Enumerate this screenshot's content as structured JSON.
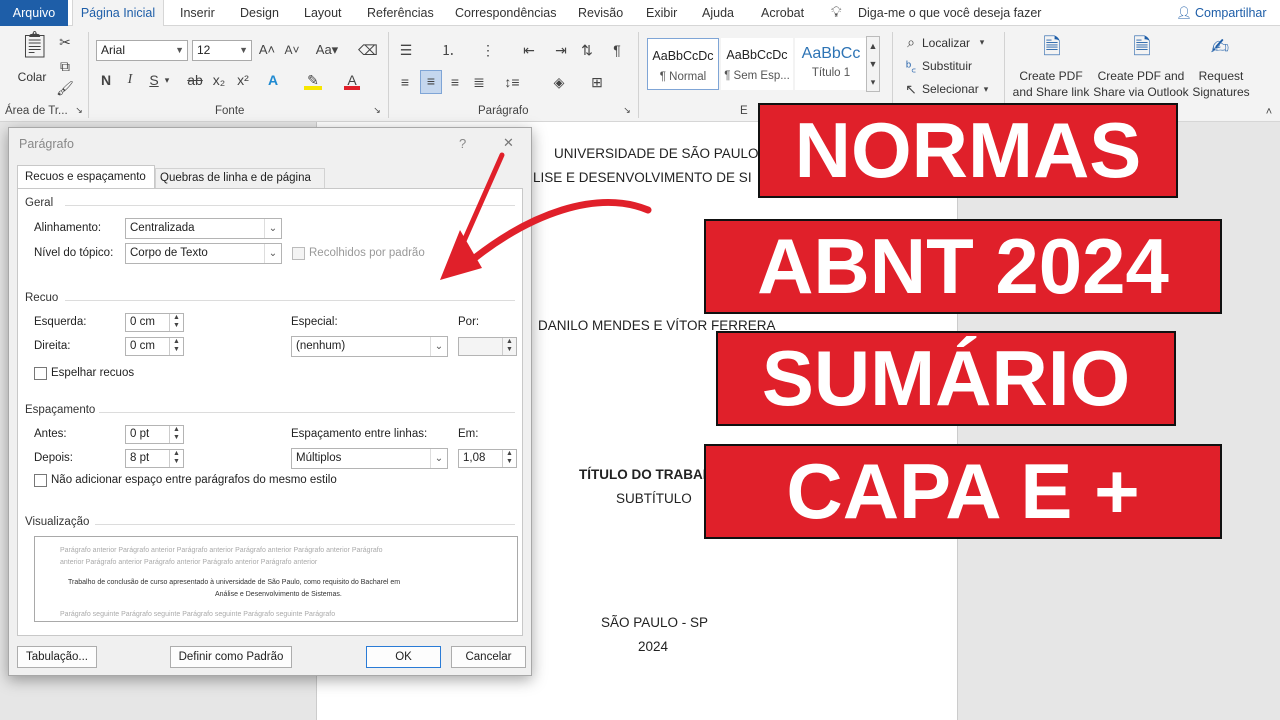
{
  "menu": {
    "file": "Arquivo",
    "tabs": [
      "Página Inicial",
      "Inserir",
      "Design",
      "Layout",
      "Referências",
      "Correspondências",
      "Revisão",
      "Exibir",
      "Ajuda",
      "Acrobat"
    ],
    "tell_me": "Diga-me o que você deseja fazer",
    "share": "Compartilhar"
  },
  "ribbon": {
    "paste": "Colar",
    "clipboard": "Área de Tr...",
    "font_name": "Arial",
    "font_size": "12",
    "font_group": "Fonte",
    "paragraph_group": "Parágrafo",
    "styles": [
      {
        "preview": "AaBbCcDc",
        "name": "¶ Normal"
      },
      {
        "preview": "AaBbCcDc",
        "name": "¶ Sem Esp..."
      },
      {
        "preview": "AaBbCc",
        "name": "Título 1"
      }
    ],
    "styles_group": "E",
    "find": "Localizar",
    "replace": "Substituir",
    "select": "Selecionar",
    "pdf1_l1": "Create PDF",
    "pdf1_l2": "and Share link",
    "pdf2_l1": "Create PDF and",
    "pdf2_l2": "Share via Outlook",
    "sig_l1": "Request",
    "sig_l2": "Signatures"
  },
  "document": {
    "university": "UNIVERSIDADE DE SÃO PAULO",
    "course": "LISE E DESENVOLVIMENTO DE SI",
    "authors": "DANILO MENDES E VÍTOR FERRERA",
    "title": "TÍTULO DO TRABAL",
    "subtitle": "SUBTÍTULO",
    "city": "SÃO PAULO - SP",
    "year": "2024"
  },
  "dialog": {
    "title": "Parágrafo",
    "help": "?",
    "close": "✕",
    "tab1": "Recuos e espaçamento",
    "tab2": "Quebras de linha e de página",
    "general": "Geral",
    "alignment_label": "Alinhamento:",
    "alignment_value": "Centralizada",
    "outline_label": "Nível do tópico:",
    "outline_value": "Corpo de Texto",
    "collapsed": "Recolhidos por padrão",
    "indent": "Recuo",
    "left_label": "Esquerda:",
    "left_value": "0 cm",
    "right_label": "Direita:",
    "right_value": "0 cm",
    "special_label": "Especial:",
    "special_value": "(nenhum)",
    "by_label": "Por:",
    "mirror": "Espelhar recuos",
    "spacing": "Espaçamento",
    "before_label": "Antes:",
    "before_value": "0 pt",
    "after_label": "Depois:",
    "after_value": "8 pt",
    "line_spacing_label": "Espaçamento entre linhas:",
    "line_spacing_value": "Múltiplos",
    "at_label": "Em:",
    "at_value": "1,08",
    "no_space": "Não adicionar espaço entre parágrafos do mesmo estilo",
    "preview": "Visualização",
    "preview_prev": "Parágrafo anterior Parágrafo anterior Parágrafo anterior Parágrafo anterior Parágrafo anterior Parágrafo",
    "preview_prev2": "anterior Parágrafo anterior Parágrafo anterior Parágrafo anterior Parágrafo anterior",
    "preview_text1": "Trabalho de conclusão de curso apresentado à universidade de São Paulo, como requisito do Bacharel em",
    "preview_text2": "Análise e Desenvolvimento de Sistemas.",
    "preview_next": "Parágrafo seguinte Parágrafo seguinte Parágrafo seguinte Parágrafo seguinte Parágrafo",
    "tabs_btn": "Tabulação...",
    "default_btn": "Definir como Padrão",
    "ok": "OK",
    "cancel": "Cancelar"
  },
  "overlay": {
    "line1": "NORMAS",
    "line2": "ABNT 2024",
    "line3": "SUMÁRIO",
    "line4": "CAPA E +",
    "banner_color": "#e0202a",
    "arrow_color": "#e0202a"
  }
}
